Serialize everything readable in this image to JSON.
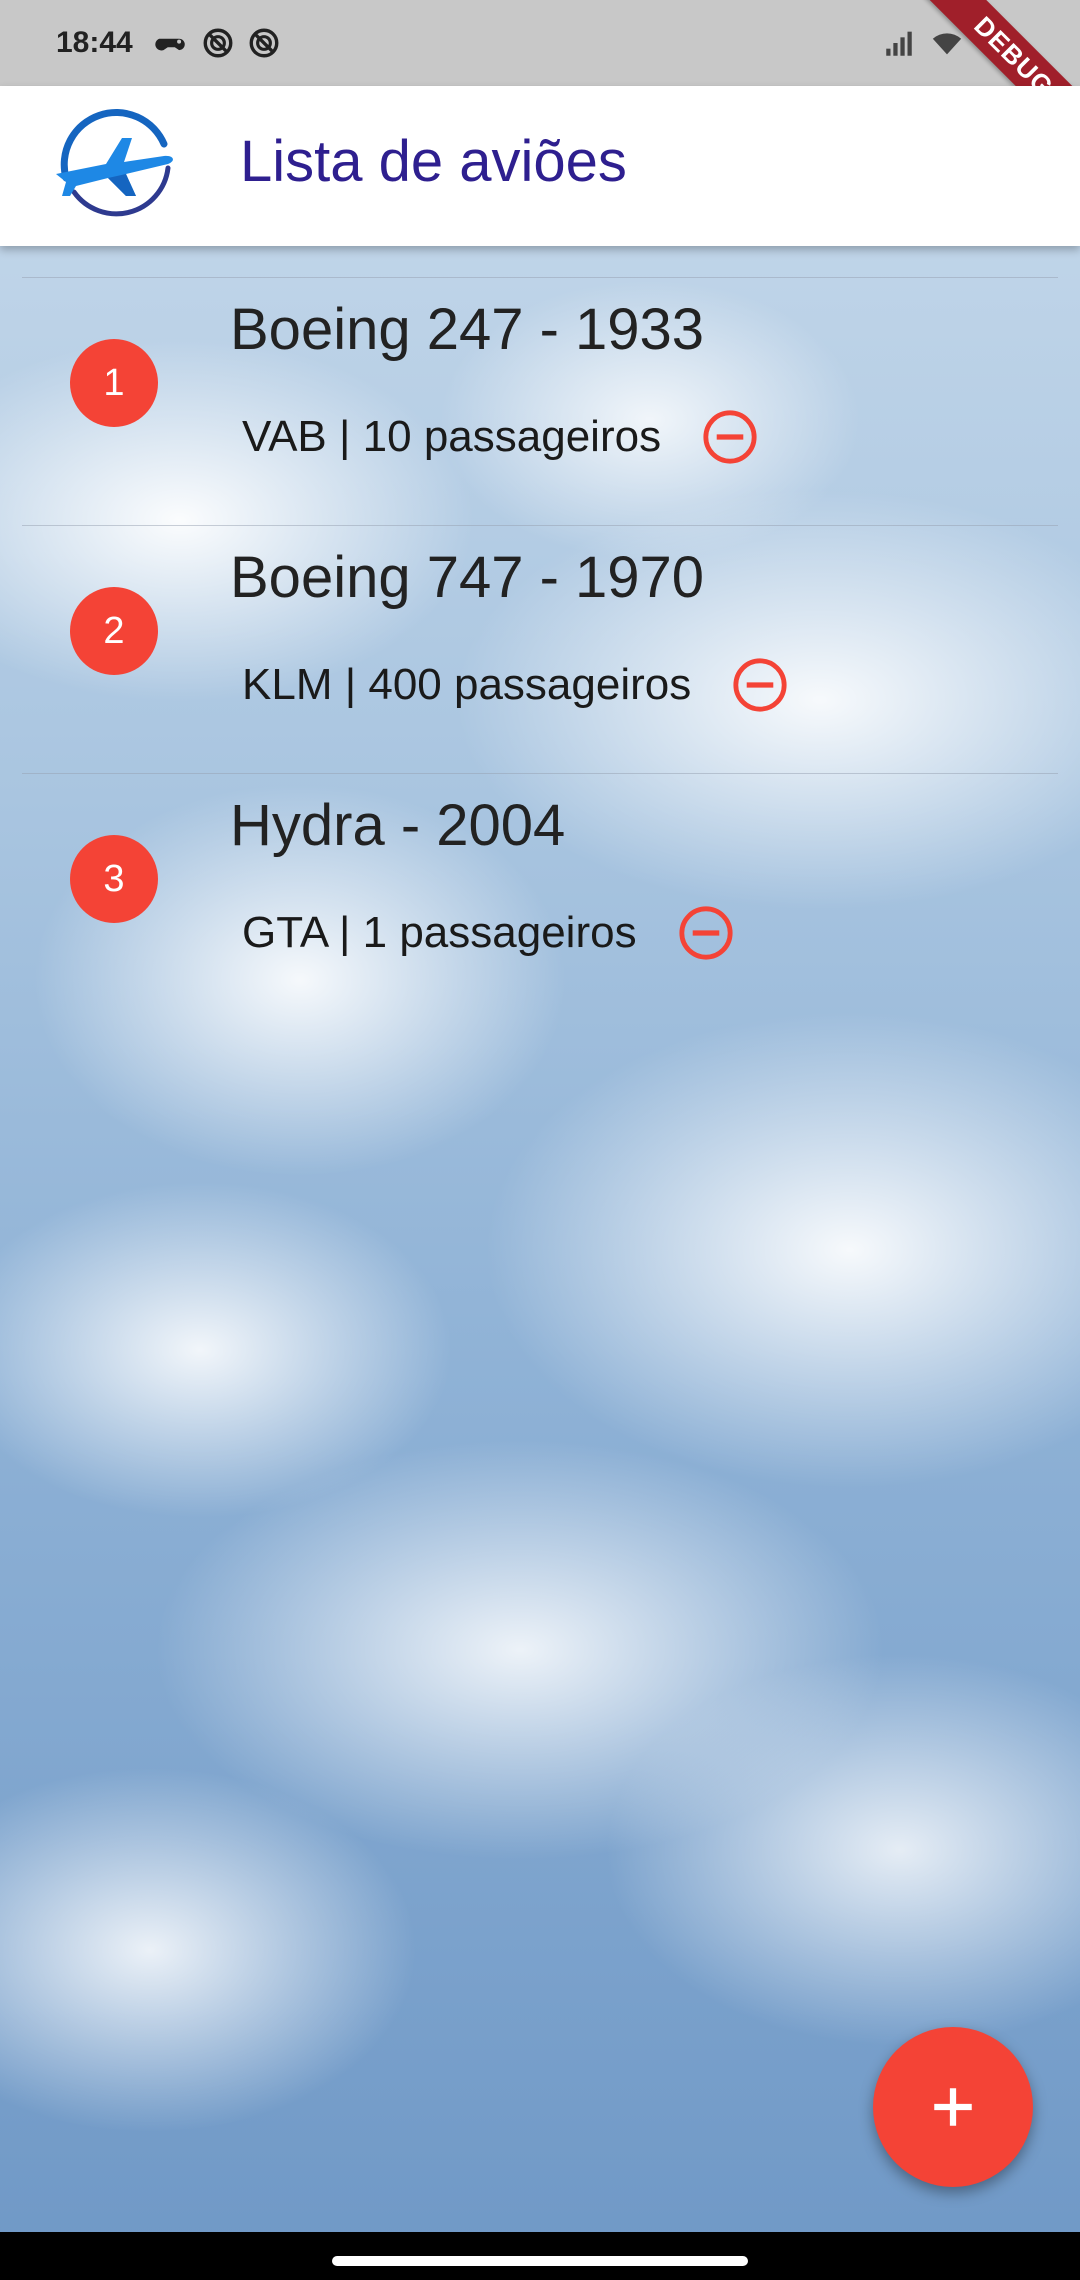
{
  "status_bar": {
    "time": "18:44",
    "icons": [
      "game-controller-icon",
      "no-disturb-icon",
      "no-disturb-icon",
      "signal-icon",
      "wifi-icon",
      "battery-icon"
    ]
  },
  "debug_banner": "DEBUG",
  "app_bar": {
    "title": "Lista de aviões",
    "logo_icon": "airplane-logo-icon"
  },
  "planes": [
    {
      "index": "1",
      "title": "Boeing 247 - 1933",
      "subtitle": "VAB | 10 passageiros"
    },
    {
      "index": "2",
      "title": "Boeing 747 - 1970",
      "subtitle": "KLM | 400 passageiros"
    },
    {
      "index": "3",
      "title": "Hydra - 2004",
      "subtitle": "GTA | 1 passageiros"
    }
  ],
  "fab": {
    "icon": "plus-icon"
  },
  "colors": {
    "accent": "#f44336",
    "title": "#2e1f8f",
    "status_bar": "#c8c8c8",
    "debug_ribbon": "#a01f2a"
  }
}
